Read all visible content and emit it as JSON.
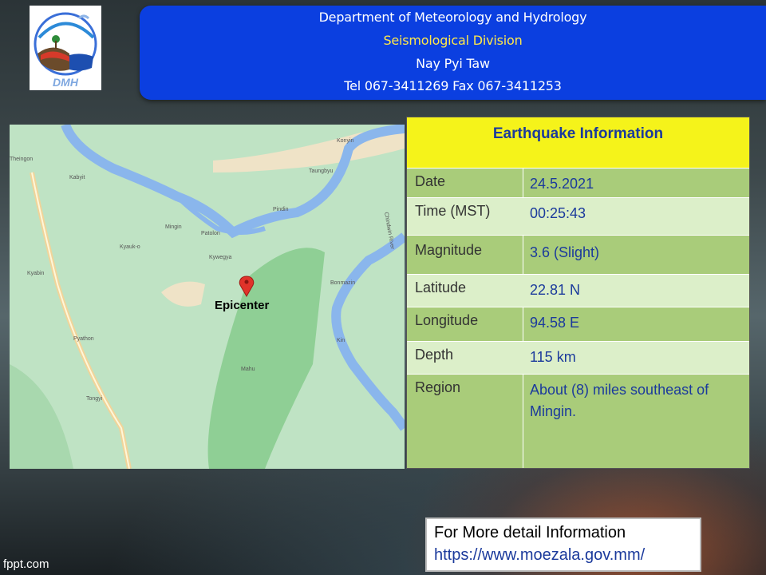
{
  "header": {
    "line1": "Department of Meteorology and Hydrology",
    "line2": "Seismological Division",
    "line3": "Nay Pyi Taw",
    "line4": "Tel 067-3411269 Fax 067-3411253"
  },
  "logo": {
    "text": "DMH"
  },
  "map": {
    "epicenter_label": "Epicenter",
    "places": [
      "Theingon",
      "Kabyit",
      "Konyin",
      "Taungbyu",
      "Pindin",
      "Mingin",
      "Patolon",
      "Kyauk-o",
      "Kywegya",
      "Kyabin",
      "Bonmazin",
      "Pyathon",
      "Kin",
      "Mahu",
      "Tongyi",
      "Chindwin River"
    ]
  },
  "info": {
    "title": "Earthquake Information",
    "rows": [
      {
        "label": "Date",
        "value": "24.5.2021"
      },
      {
        "label": "Time (MST)",
        "value": "00:25:43"
      },
      {
        "label": "Magnitude",
        "value": "3.6 (Slight)"
      },
      {
        "label": "Latitude",
        "value": "22.81 N"
      },
      {
        "label": "Longitude",
        "value": "94.58 E"
      },
      {
        "label": "Depth",
        "value": "115 km"
      },
      {
        "label": "Region",
        "value": "About (8)  miles southeast of  Mingin."
      }
    ]
  },
  "footer": {
    "line1": "For More detail Information",
    "line2": "https://www.moezala.gov.mm/",
    "watermark": "fppt.com"
  },
  "colors": {
    "header_bg": "#0b3fe0",
    "info_head": "#f5f31a",
    "row_green": "#a9cc7a",
    "row_light": "#dcefc9",
    "value_blue": "#1b3a9c"
  },
  "icons": [
    "map-pin-icon"
  ]
}
